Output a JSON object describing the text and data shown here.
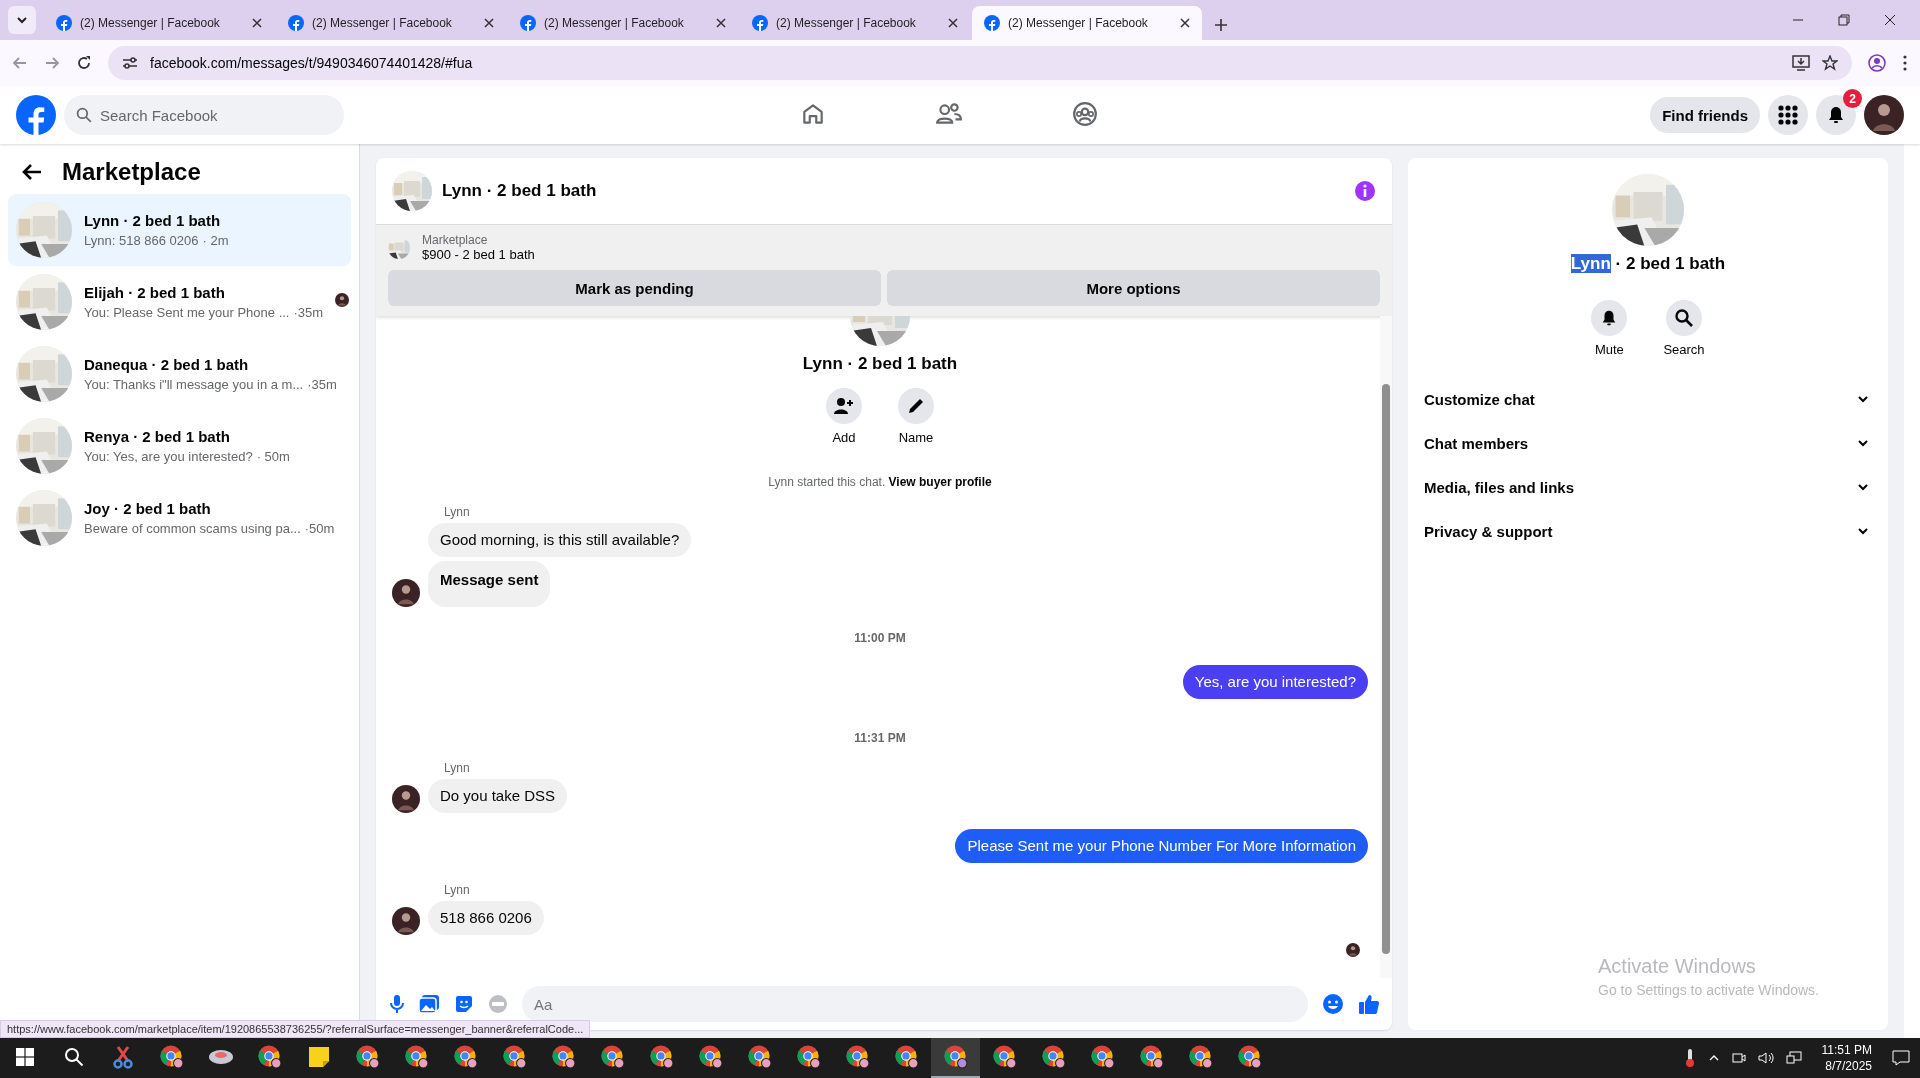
{
  "browser": {
    "tabs": [
      {
        "title": "(2) Messenger | Facebook",
        "selected": false
      },
      {
        "title": "(2) Messenger | Facebook",
        "selected": false
      },
      {
        "title": "(2) Messenger | Facebook",
        "selected": false
      },
      {
        "title": "(2) Messenger | Facebook",
        "selected": false
      },
      {
        "title": "(2) Messenger | Facebook",
        "selected": true
      }
    ],
    "url": "facebook.com/messages/t/9490346074401428/#fua"
  },
  "header": {
    "search_placeholder": "Search Facebook",
    "nav": [
      {
        "kind": "home",
        "selected": false
      },
      {
        "kind": "friends",
        "selected": false
      },
      {
        "kind": "groups",
        "selected": false
      }
    ],
    "find_friends": "Find friends",
    "notification_badge": "2"
  },
  "sidebar": {
    "title": "Marketplace",
    "chats": [
      {
        "name": "Lynn · 2 bed 1 bath",
        "preview": "Lynn: 518 866 0206",
        "time": "· 2m",
        "selected": true,
        "seen": false
      },
      {
        "name": "Elijah · 2 bed 1 bath",
        "preview": "You: Please Sent me your Phone ...",
        "time": "·35m",
        "selected": false,
        "seen": true
      },
      {
        "name": "Danequa · 2 bed 1 bath",
        "preview": "You: Thanks i\"ll message you in a m...",
        "time": "·35m",
        "selected": false,
        "seen": false
      },
      {
        "name": "Renya · 2 bed 1 bath",
        "preview": "You: Yes, are you interested?",
        "time": "· 50m",
        "selected": false,
        "seen": false
      },
      {
        "name": "Joy · 2 bed 1 bath",
        "preview": "Beware of common scams using pa...",
        "time": "·50m",
        "selected": false,
        "seen": false
      }
    ]
  },
  "chat": {
    "title": "Lynn · 2 bed 1 bath",
    "listing": {
      "label": "Marketplace",
      "title": "$900 - 2 bed 1 bath"
    },
    "actions": [
      "Mark as pending",
      "More options"
    ],
    "intro": {
      "name": "Lynn · 2 bed 1 bath",
      "buttons": [
        {
          "kind": "add",
          "label": "Add"
        },
        {
          "kind": "name",
          "label": "Name"
        }
      ],
      "notice": "Lynn started this chat.",
      "notice_link": "View buyer profile"
    },
    "items": [
      {
        "kind": "sender",
        "text": "Lynn"
      },
      {
        "kind": "incoming",
        "text": "Good morning, is this still available?",
        "avatar": false
      },
      {
        "kind": "system",
        "text": "Message sent",
        "avatar": true
      },
      {
        "kind": "time",
        "text": "11:00 PM"
      },
      {
        "kind": "outgoing",
        "text": "Yes, are you interested?",
        "color": "#4a3ff2"
      },
      {
        "kind": "time",
        "text": "11:31 PM"
      },
      {
        "kind": "sender",
        "text": "Lynn"
      },
      {
        "kind": "incoming",
        "text": "Do you take DSS",
        "avatar": true
      },
      {
        "kind": "outgoing",
        "text": "Please Sent me your Phone Number For More Information",
        "color": "#1e5ef6"
      },
      {
        "kind": "sender",
        "text": "Lynn"
      },
      {
        "kind": "incoming",
        "text": "518 866 0206",
        "avatar": true
      }
    ],
    "composer": {
      "placeholder": "Aa"
    }
  },
  "details": {
    "title": [
      {
        "text": "Lynn",
        "highlighted": true
      },
      {
        "text": " · 2 bed 1 bath",
        "highlighted": false
      }
    ],
    "actions": [
      {
        "kind": "mute",
        "label": "Mute"
      },
      {
        "kind": "search",
        "label": "Search"
      }
    ],
    "sections": [
      "Customize chat",
      "Chat members",
      "Media, files and links",
      "Privacy & support"
    ]
  },
  "status_link": "https://www.facebook.com/marketplace/item/1920865538736255/?referralSurface=messenger_banner&referralCode...",
  "activation": {
    "title": "Activate Windows",
    "hint": "Go to Settings to activate Windows."
  },
  "taskbar": {
    "apps": [
      {
        "kind": "snip",
        "selected": false
      },
      {
        "kind": "chrome",
        "selected": false
      },
      {
        "kind": "app",
        "selected": false
      },
      {
        "kind": "chrome",
        "selected": false
      },
      {
        "kind": "notes",
        "selected": false
      },
      {
        "kind": "chrome",
        "selected": false
      },
      {
        "kind": "chrome",
        "selected": false
      },
      {
        "kind": "chrome",
        "selected": false
      },
      {
        "kind": "chrome",
        "selected": false
      },
      {
        "kind": "chrome",
        "selected": false
      },
      {
        "kind": "chrome",
        "selected": false
      },
      {
        "kind": "chrome",
        "selected": false
      },
      {
        "kind": "chrome",
        "selected": false
      },
      {
        "kind": "chrome",
        "selected": false
      },
      {
        "kind": "chrome",
        "selected": false
      },
      {
        "kind": "chrome",
        "selected": false
      },
      {
        "kind": "chrome",
        "selected": false
      },
      {
        "kind": "chrome",
        "selected": true
      },
      {
        "kind": "chrome",
        "selected": false
      },
      {
        "kind": "chrome",
        "selected": false
      },
      {
        "kind": "chrome",
        "selected": false
      },
      {
        "kind": "chrome",
        "selected": false
      },
      {
        "kind": "chrome",
        "selected": false
      },
      {
        "kind": "chrome",
        "selected": false
      }
    ],
    "time": "11:51 PM",
    "date": "8/7/2025"
  }
}
